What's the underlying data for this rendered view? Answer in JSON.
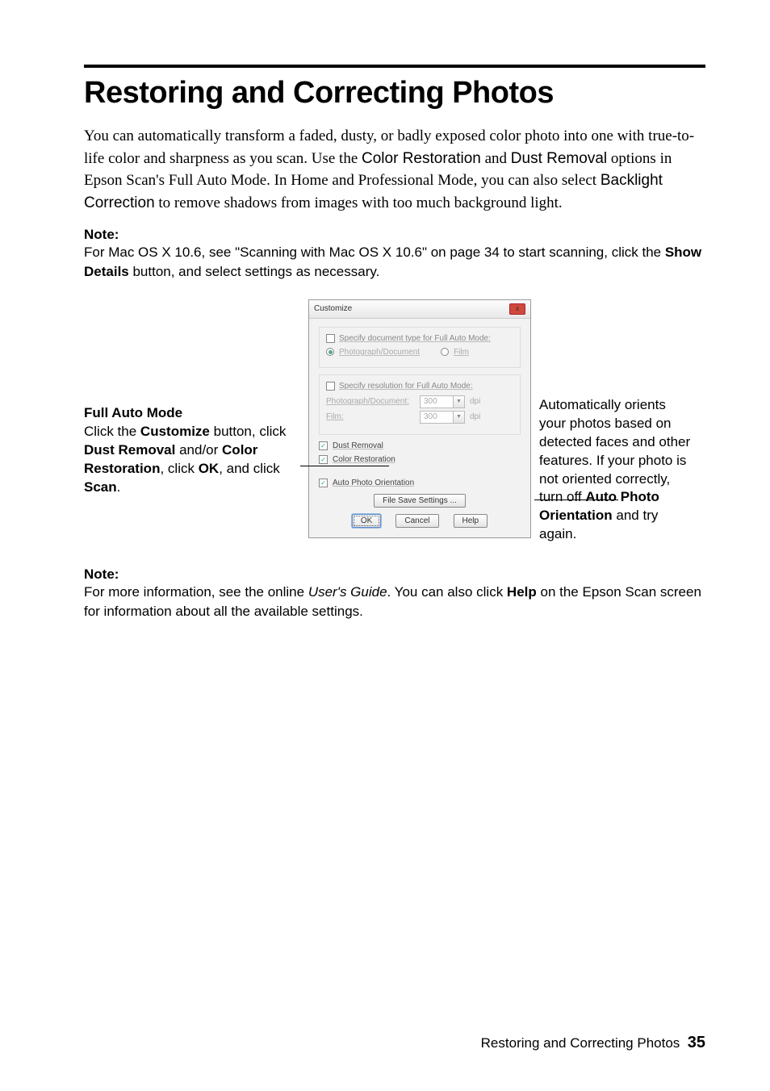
{
  "heading": "Restoring and Correcting Photos",
  "intro": {
    "p1a": "You can automatically transform a faded, dusty, or badly exposed color photo into one with true-to-life color and sharpness as you scan. Use the ",
    "cr": "Color Restoration",
    "p1b": " and ",
    "dr": "Dust Removal",
    "p1c": " options in Epson Scan's Full Auto Mode. In Home and Professional Mode, you can also select ",
    "bc": "Backlight Correction",
    "p1d": " to remove shadows from images with too much background light."
  },
  "note1": {
    "label": "Note:",
    "a": "For Mac OS X 10.6, see \"Scanning with Mac OS X 10.6\" on page 34 to start scanning, click the ",
    "sd": "Show Details",
    "b": " button, and select settings as necessary."
  },
  "left": {
    "title": "Full Auto Mode",
    "a": "Click the ",
    "cust": "Customize",
    "b": " button, click ",
    "dr": "Dust Removal",
    "c": " and/or ",
    "cr": "Color Restoration",
    "d": ", click ",
    "ok": "OK",
    "e": ", and click ",
    "scan": "Scan",
    "f": "."
  },
  "right": {
    "a": "Automatically orients your photos based on detected faces and other features. If your photo is not oriented correctly, turn off ",
    "apo": "Auto Photo Orientation",
    "b": " and try again."
  },
  "dialog": {
    "title": "Customize",
    "close": "x",
    "grp1_label": "Specify document type for Full Auto Mode:",
    "opt_photo": "Photograph/Document",
    "opt_film": "Film",
    "grp2_label": "Specify resolution for Full Auto Mode:",
    "row_photo": "Photograph/Document:",
    "row_film": "Film:",
    "dpi": "dpi",
    "val300": "300",
    "cb_dust": "Dust Removal",
    "cb_color": "Color Restoration",
    "cb_auto": "Auto Photo Orientation",
    "file_save": "File Save Settings ...",
    "ok": "OK",
    "cancel": "Cancel",
    "help": "Help"
  },
  "note2": {
    "label": "Note:",
    "a": "For more information, see the online ",
    "ug": "User's Guide",
    "b": ". You can also click ",
    "help": "Help",
    "c": " on the Epson Scan screen for information about all the available settings."
  },
  "footer": {
    "text": "Restoring and Correcting Photos",
    "page": "35"
  }
}
